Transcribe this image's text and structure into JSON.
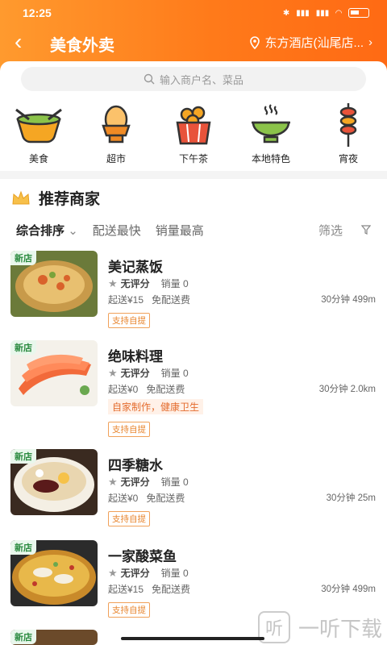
{
  "status": {
    "time": "12:25",
    "icons": [
      "bluetooth-icon",
      "signal-icon",
      "signal-icon",
      "wifi-icon",
      "battery-icon"
    ]
  },
  "nav": {
    "title": "美食外卖",
    "location": "东方酒店(汕尾店..."
  },
  "search": {
    "placeholder": "输入商户名、菜品"
  },
  "categories": [
    {
      "label": "美食",
      "icon": "food-bowl-icon"
    },
    {
      "label": "超市",
      "icon": "egg-cup-icon"
    },
    {
      "label": "下午茶",
      "icon": "donut-box-icon"
    },
    {
      "label": "本地特色",
      "icon": "steaming-bowl-icon"
    },
    {
      "label": "宵夜",
      "icon": "skewer-icon"
    }
  ],
  "recommend": {
    "title": "推荐商家"
  },
  "sorts": {
    "comprehensive": "综合排序",
    "fastest": "配送最快",
    "best_sales": "销量最高",
    "filter": "筛选"
  },
  "shops": [
    {
      "name": "美记蒸饭",
      "tag": "新店",
      "rating": "无评分",
      "sales": "销量 0",
      "min": "起送¥15",
      "fee": "免配送费",
      "distance": "30分钟 499m",
      "slogan": "",
      "pickup": "支持自提"
    },
    {
      "name": "绝味料理",
      "tag": "新店",
      "rating": "无评分",
      "sales": "销量 0",
      "min": "起送¥0",
      "fee": "免配送费",
      "distance": "30分钟 2.0km",
      "slogan": "自家制作，健康卫生",
      "pickup": "支持自提"
    },
    {
      "name": "四季糖水",
      "tag": "新店",
      "rating": "无评分",
      "sales": "销量 0",
      "min": "起送¥0",
      "fee": "免配送费",
      "distance": "30分钟 25m",
      "slogan": "",
      "pickup": "支持自提"
    },
    {
      "name": "一家酸菜鱼",
      "tag": "新店",
      "rating": "无评分",
      "sales": "销量 0",
      "min": "起送¥15",
      "fee": "免配送费",
      "distance": "30分钟 499m",
      "slogan": "",
      "pickup": "支持自提"
    }
  ],
  "partial_tag": "新店",
  "watermark": {
    "glyph": "听",
    "text": "一听下载"
  },
  "colors": {
    "header_start": "#ff9a2e",
    "header_end": "#ff6a14",
    "new_tag": "#2a8a3f",
    "pickup": "#e8862f"
  }
}
